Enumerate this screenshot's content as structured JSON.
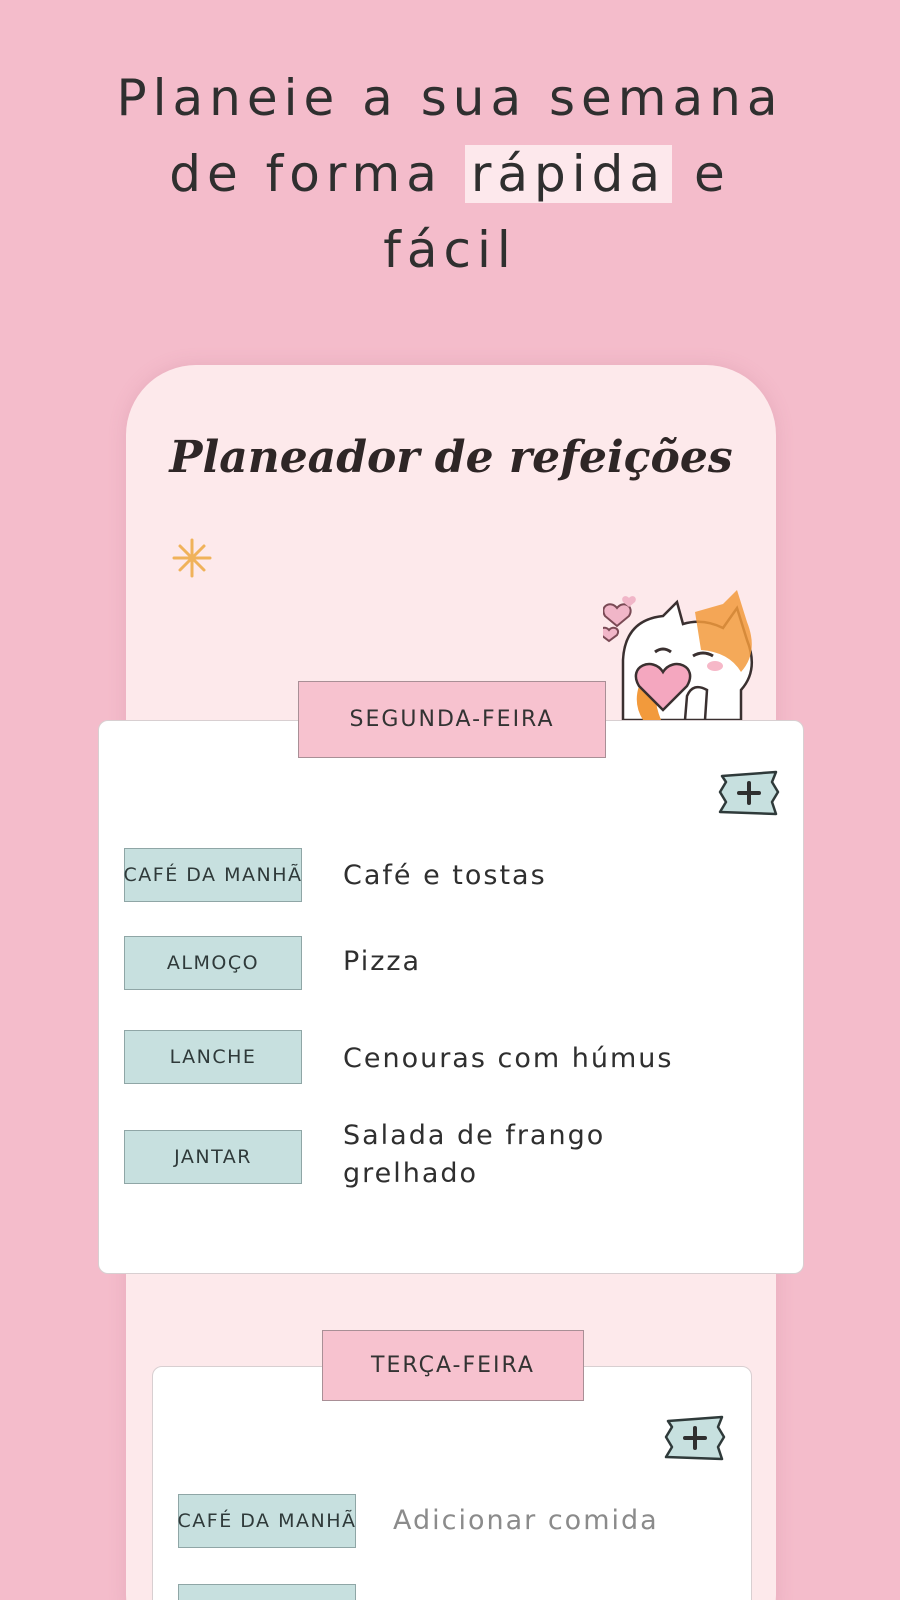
{
  "headline": {
    "line1": "Planeie a sua semana",
    "line2_start": "de forma",
    "line2_highlight": "rápida",
    "line2_end": "e",
    "line3": "fácil"
  },
  "app": {
    "title": "Planeador de refeições"
  },
  "days": [
    {
      "name": "SEGUNDA-FEIRA",
      "meals": [
        {
          "label": "CAFÉ DA MANHÃ",
          "value": "Café e tostas"
        },
        {
          "label": "ALMOÇO",
          "value": "Pizza"
        },
        {
          "label": "LANCHE",
          "value": "Cenouras com húmus"
        },
        {
          "label": "JANTAR",
          "value": "Salada de frango grelhado"
        }
      ]
    },
    {
      "name": "TERÇA-FEIRA",
      "meals": [
        {
          "label": "CAFÉ DA MANHÃ",
          "placeholder": "Adicionar comida"
        }
      ]
    }
  ],
  "icons": {
    "add": "plus-icon",
    "sparkle": "sparkle-icon",
    "mascot": "cat-mascot"
  },
  "colors": {
    "background": "#f4bccb",
    "phone": "#fde9eb",
    "day_tab": "#f7c2cf",
    "meal_label": "#c7e0df",
    "add_button": "#c7e0df"
  }
}
